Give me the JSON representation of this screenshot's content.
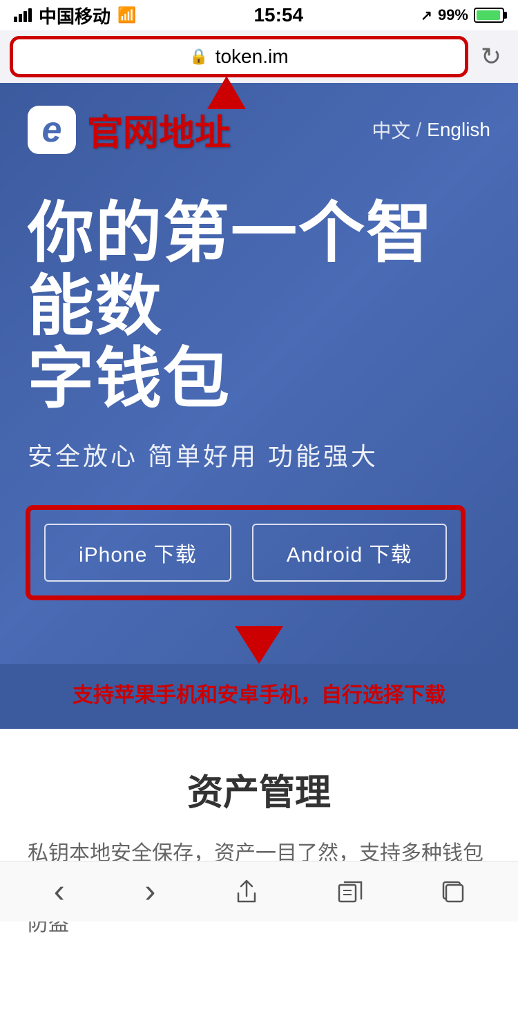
{
  "status_bar": {
    "carrier": "中国移动",
    "time": "15:54",
    "battery_pct": "99%"
  },
  "browser": {
    "url": "token.im",
    "refresh_label": "↻"
  },
  "header": {
    "logo_char": "e",
    "logo_label": "官网地址",
    "lang_cn": "中文",
    "lang_divider": "/",
    "lang_en": "English"
  },
  "hero": {
    "title": "你的第一个智能数\n字钱包",
    "subtitle": "安全放心  简单好用  功能强大"
  },
  "buttons": {
    "iphone": "iPhone 下载",
    "android": "Android 下载"
  },
  "annotation": "支持苹果手机和安卓手机，自行选择下载",
  "section": {
    "title": "资产管理",
    "body": "私钥本地安全保存，资产一目了然，支持多种钱包类型，轻松导入导出，助记词备份防丢，多重签名防盗"
  },
  "bottom_nav": {
    "back": "‹",
    "forward": "›",
    "share": "↑",
    "bookmarks": "□□",
    "tabs": "⧉"
  }
}
